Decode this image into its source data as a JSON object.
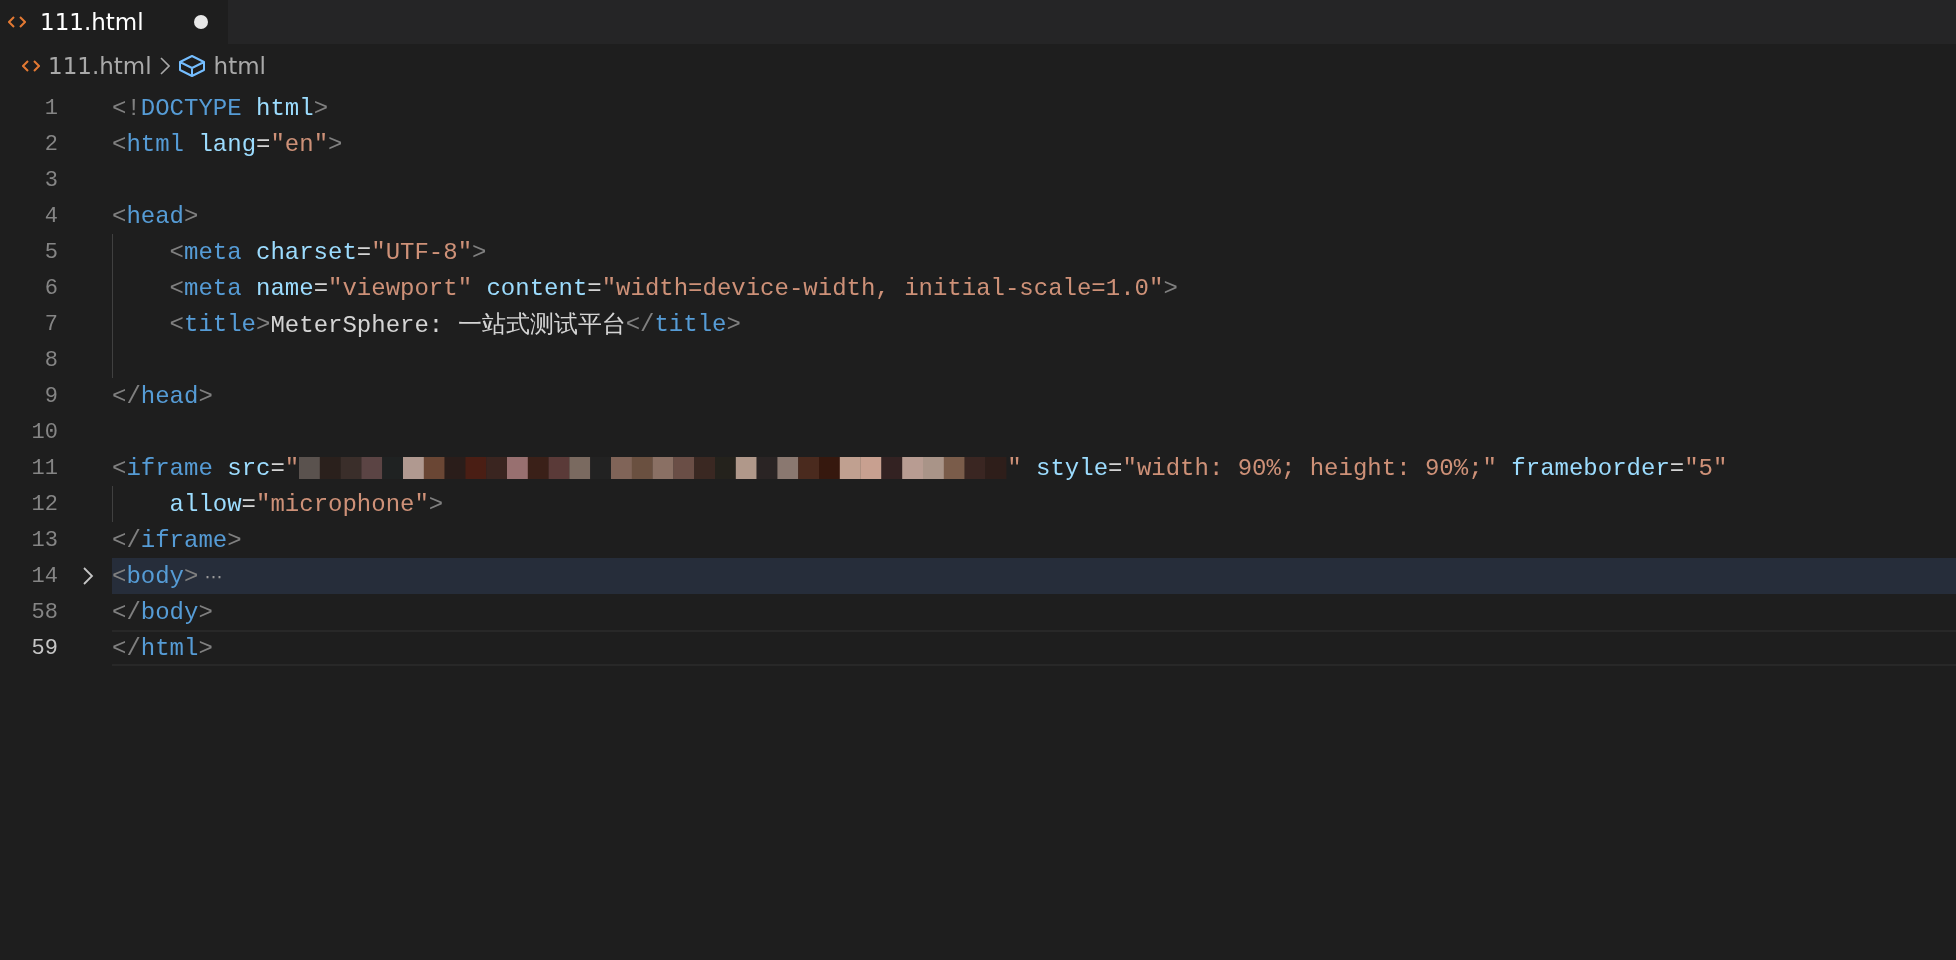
{
  "tabs": [
    {
      "label": "111.html",
      "selected": true,
      "dirty": true
    }
  ],
  "breadcrumb": [
    {
      "label": "111.html",
      "kind": "file"
    },
    {
      "label": "html",
      "kind": "element"
    }
  ],
  "editor": {
    "lines": [
      {
        "number": "1",
        "kind": "top",
        "tokens": [
          {
            "kind": "punct",
            "text": "<!"
          },
          {
            "kind": "tag",
            "text": "DOCTYPE"
          },
          {
            "kind": "attr",
            "text": " html"
          },
          {
            "kind": "punct",
            "text": ">"
          }
        ]
      },
      {
        "number": "2",
        "kind": "top",
        "tokens": [
          {
            "kind": "punct",
            "text": "<"
          },
          {
            "kind": "tag",
            "text": "html"
          },
          {
            "kind": "attr",
            "text": " lang"
          },
          {
            "kind": "text",
            "text": "="
          },
          {
            "kind": "string",
            "text": "\"en\""
          },
          {
            "kind": "punct",
            "text": ">"
          }
        ]
      },
      {
        "number": "3",
        "kind": "top"
      },
      {
        "number": "4",
        "kind": "top",
        "tokens": [
          {
            "kind": "punct",
            "text": "<"
          },
          {
            "kind": "tag",
            "text": "head"
          },
          {
            "kind": "punct",
            "text": ">"
          }
        ]
      },
      {
        "number": "5",
        "kind": "indented",
        "tokens": [
          {
            "kind": "punct",
            "text": "<"
          },
          {
            "kind": "tag",
            "text": "meta"
          },
          {
            "kind": "attr",
            "text": " charset"
          },
          {
            "kind": "text",
            "text": "="
          },
          {
            "kind": "string",
            "text": "\"UTF-8\""
          },
          {
            "kind": "punct",
            "text": ">"
          }
        ]
      },
      {
        "number": "6",
        "kind": "indented",
        "tokens": [
          {
            "kind": "punct",
            "text": "<"
          },
          {
            "kind": "tag",
            "text": "meta"
          },
          {
            "kind": "attr",
            "text": " name"
          },
          {
            "kind": "text",
            "text": "="
          },
          {
            "kind": "string",
            "text": "\"viewport\""
          },
          {
            "kind": "attr",
            "text": " content"
          },
          {
            "kind": "text",
            "text": "="
          },
          {
            "kind": "string",
            "text": "\"width=device-width, initial-scale=1.0\""
          },
          {
            "kind": "punct",
            "text": ">"
          }
        ]
      },
      {
        "number": "7",
        "kind": "indented",
        "tokens": [
          {
            "kind": "punct",
            "text": "<"
          },
          {
            "kind": "tag",
            "text": "title"
          },
          {
            "kind": "punct",
            "text": ">"
          },
          {
            "kind": "text",
            "text": "MeterSphere: 一站式测试平台"
          },
          {
            "kind": "punct",
            "text": "</"
          },
          {
            "kind": "tag",
            "text": "title"
          },
          {
            "kind": "punct",
            "text": ">"
          }
        ]
      },
      {
        "number": "8",
        "kind": "indented"
      },
      {
        "number": "9",
        "kind": "top",
        "tokens": [
          {
            "kind": "punct",
            "text": "</"
          },
          {
            "kind": "tag",
            "text": "head"
          },
          {
            "kind": "punct",
            "text": ">"
          }
        ]
      },
      {
        "number": "10",
        "kind": "top"
      },
      {
        "number": "11",
        "kind": "top",
        "tokens": [
          {
            "kind": "punct",
            "text": "<"
          },
          {
            "kind": "tag",
            "text": "iframe"
          },
          {
            "kind": "attr",
            "text": " src"
          },
          {
            "kind": "text",
            "text": "="
          },
          {
            "kind": "string",
            "text": "\""
          },
          {
            "kind": "redacted"
          },
          {
            "kind": "string",
            "text": "\""
          },
          {
            "kind": "attr",
            "text": " style"
          },
          {
            "kind": "text",
            "text": "="
          },
          {
            "kind": "string",
            "text": "\"width: 90%; height: 90%;\""
          },
          {
            "kind": "attr",
            "text": " frameborder"
          },
          {
            "kind": "text",
            "text": "="
          },
          {
            "kind": "string",
            "text": "\"5\""
          }
        ]
      },
      {
        "number": "12",
        "kind": "indented",
        "tokens": [
          {
            "kind": "attr",
            "text": "allow"
          },
          {
            "kind": "text",
            "text": "="
          },
          {
            "kind": "string",
            "text": "\"microphone\""
          },
          {
            "kind": "punct",
            "text": ">"
          }
        ]
      },
      {
        "number": "13",
        "kind": "top",
        "tokens": [
          {
            "kind": "punct",
            "text": "</"
          },
          {
            "kind": "tag",
            "text": "iframe"
          },
          {
            "kind": "punct",
            "text": ">"
          }
        ]
      },
      {
        "number": "14",
        "kind": "top",
        "collapsed": true,
        "tokens": [
          {
            "kind": "punct",
            "text": "<"
          },
          {
            "kind": "tag",
            "text": "body"
          },
          {
            "kind": "punct",
            "text": ">"
          }
        ],
        "fold_marker": "⋯"
      },
      {
        "number": "58",
        "kind": "top",
        "tokens": [
          {
            "kind": "punct",
            "text": "</"
          },
          {
            "kind": "tag",
            "text": "body"
          },
          {
            "kind": "punct",
            "text": ">"
          }
        ]
      },
      {
        "number": "59",
        "kind": "top",
        "current": true,
        "tokens": [
          {
            "kind": "punct",
            "text": "</"
          },
          {
            "kind": "tag",
            "text": "html"
          },
          {
            "kind": "punct",
            "text": ">"
          }
        ]
      }
    ]
  }
}
